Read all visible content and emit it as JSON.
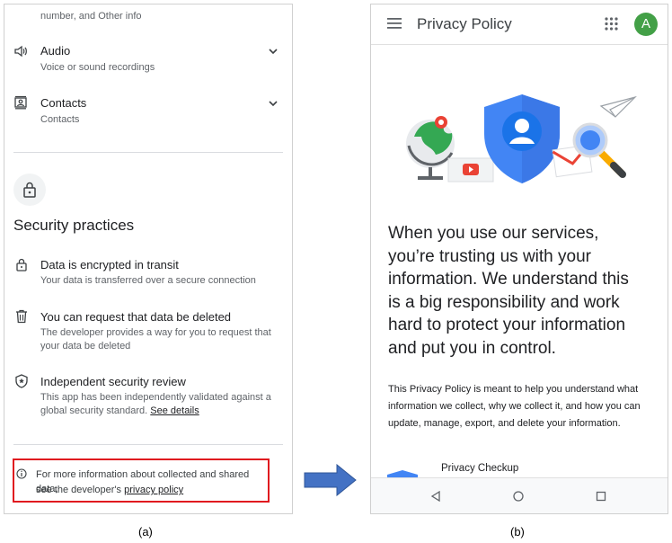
{
  "left_panel": {
    "top_partial_text": "number, and Other info",
    "items": [
      {
        "title": "Audio",
        "subtitle": "Voice or sound recordings"
      },
      {
        "title": "Contacts",
        "subtitle": "Contacts"
      }
    ],
    "security": {
      "heading": "Security practices",
      "items": [
        {
          "title": "Data is encrypted in transit",
          "desc": "Your data is transferred over a secure connection"
        },
        {
          "title": "You can request that data be deleted",
          "desc_line1": "The developer provides a way for you to request that",
          "desc_line2": "your data be deleted"
        },
        {
          "title": "Independent security review",
          "desc_line1": "This app has been independently validated against a",
          "desc_line2": "global security standard.",
          "link": "See details"
        }
      ]
    },
    "info_note": {
      "line1": "For more information about collected and shared data,",
      "line2": "see the developer's",
      "link": "privacy policy",
      "highlight_color": "#e0191f"
    }
  },
  "right_panel": {
    "header": {
      "title": "Privacy Policy",
      "avatar_letter": "A",
      "avatar_color": "#43a047"
    },
    "intro_lines": [
      "When you use our services,",
      "you’re trusting us with your",
      "information. We understand this",
      "is a big responsibility and work",
      "hard to protect your information",
      "and put you in control."
    ],
    "body_lines": [
      "This Privacy Policy is meant to help you understand what",
      "information we collect, why we collect it, and how you can",
      "update, manage, export, and delete your information."
    ],
    "section_label": "Privacy Checkup"
  },
  "captions": {
    "a": "(a)",
    "b": "(b)"
  },
  "colors": {
    "arrow": "#4472c4",
    "shield": "#4285f4"
  }
}
